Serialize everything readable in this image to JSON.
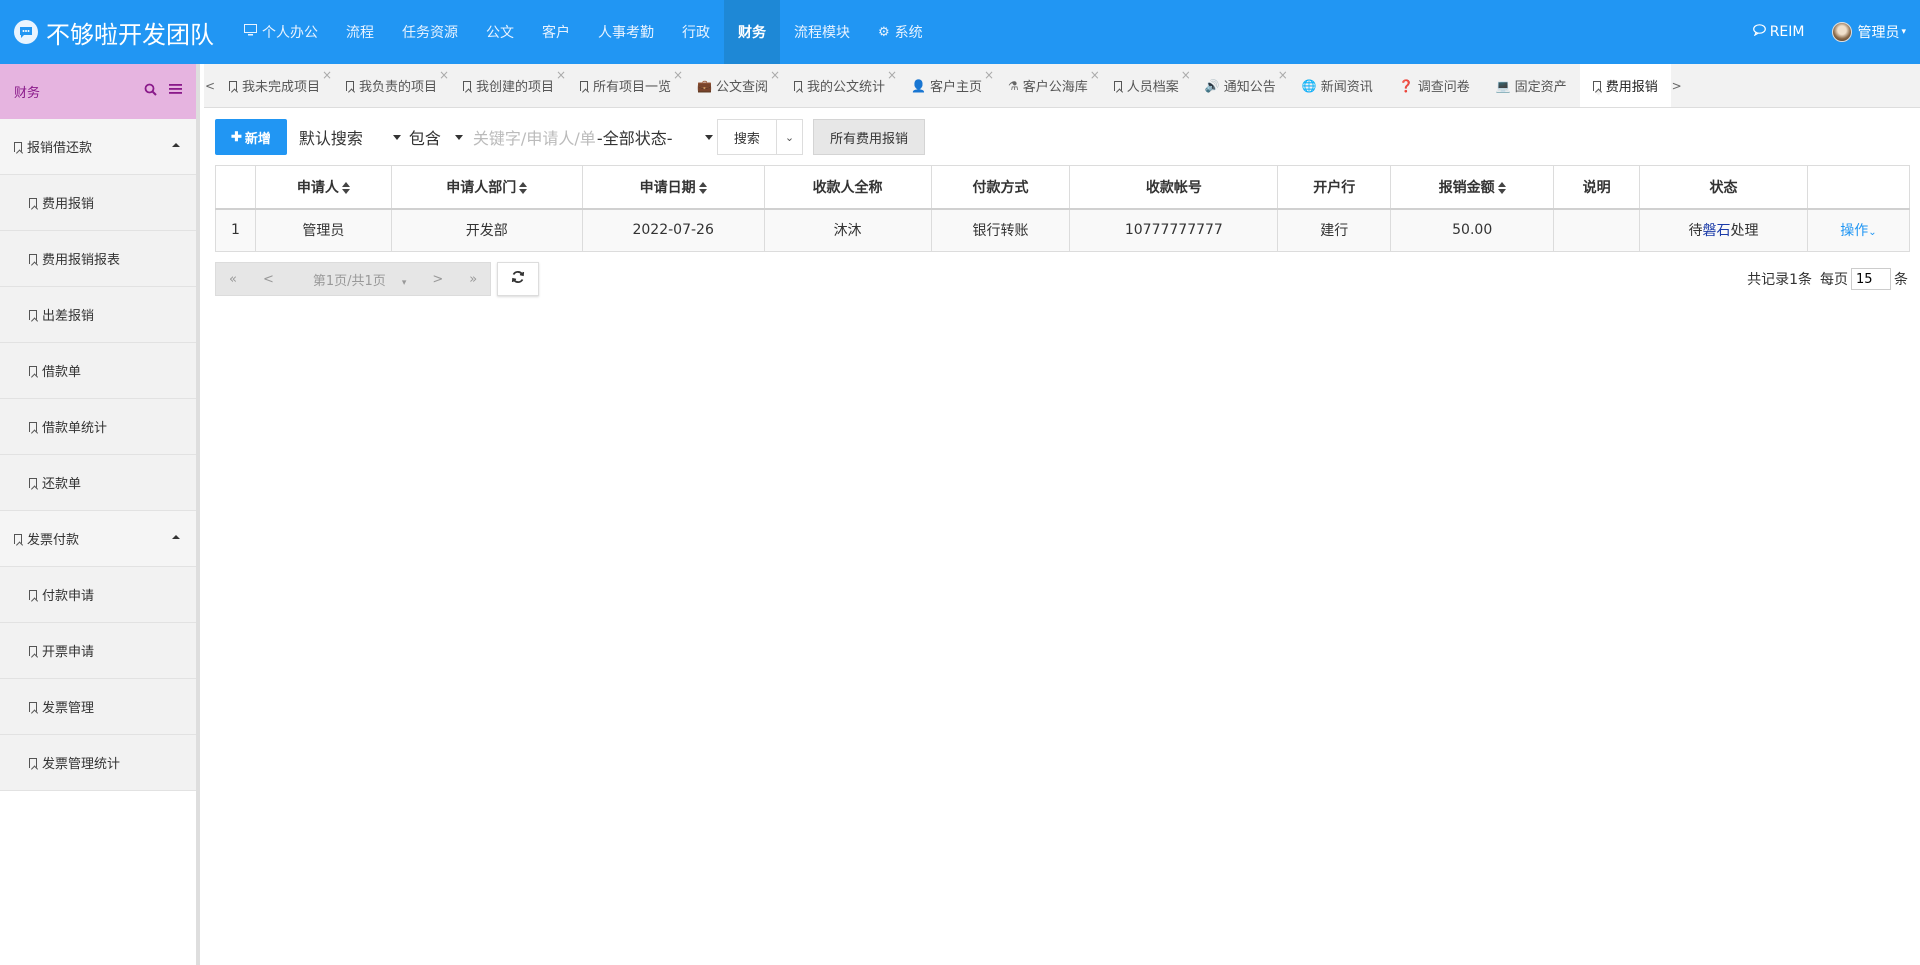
{
  "app": {
    "title": "不够啦开发团队"
  },
  "nav": [
    {
      "label": "个人办公",
      "icon": "monitor-icon"
    },
    {
      "label": "流程"
    },
    {
      "label": "任务资源"
    },
    {
      "label": "公文"
    },
    {
      "label": "客户"
    },
    {
      "label": "人事考勤"
    },
    {
      "label": "行政"
    },
    {
      "label": "财务",
      "active": true
    },
    {
      "label": "流程模块"
    },
    {
      "label": "系统",
      "icon": "gear-icon"
    }
  ],
  "topright": {
    "reim": "REIM",
    "user": "管理员"
  },
  "sidebar": {
    "title": "财务",
    "groups": [
      {
        "label": "报销借还款",
        "items": [
          "费用报销",
          "费用报销报表",
          "出差报销",
          "借款单",
          "借款单统计",
          "还款单"
        ]
      },
      {
        "label": "发票付款",
        "items": [
          "付款申请",
          "开票申请",
          "发票管理",
          "发票管理统计"
        ]
      }
    ]
  },
  "tabs": [
    {
      "label": "我未完成项目",
      "icon": "bookmark-icon"
    },
    {
      "label": "我负责的项目",
      "icon": "bookmark-icon"
    },
    {
      "label": "我创建的项目",
      "icon": "bookmark-icon"
    },
    {
      "label": "所有项目一览",
      "icon": "bookmark-icon"
    },
    {
      "label": "公文查阅",
      "icon": "briefcase-icon"
    },
    {
      "label": "我的公文统计",
      "icon": "bookmark-icon"
    },
    {
      "label": "客户主页",
      "icon": "user-icon"
    },
    {
      "label": "客户公海库",
      "icon": "flask-icon"
    },
    {
      "label": "人员档案",
      "icon": "bookmark-icon"
    },
    {
      "label": "通知公告",
      "icon": "speaker-icon"
    },
    {
      "label": "新闻资讯",
      "icon": "globe-icon"
    },
    {
      "label": "调查问卷",
      "icon": "question-icon"
    },
    {
      "label": "固定资产",
      "icon": "laptop-icon"
    },
    {
      "label": "费用报销",
      "icon": "bookmark-icon",
      "active": true
    }
  ],
  "toolbar": {
    "add_label": "新增",
    "search_mode": "默认搜索",
    "match_mode": "包含",
    "keyword_placeholder": "关键字/申请人/单",
    "status_filter": "-全部状态-",
    "search_label": "搜索",
    "all_label": "所有费用报销"
  },
  "table": {
    "columns": [
      "",
      "申请人",
      "申请人部门",
      "申请日期",
      "收款人全称",
      "付款方式",
      "收款帐号",
      "开户行",
      "报销金额",
      "说明",
      "状态",
      ""
    ],
    "rows": [
      {
        "index": "1",
        "applicant": "管理员",
        "dept": "开发部",
        "date": "2022-07-26",
        "payee": "沐沐",
        "method": "银行转账",
        "account": "10777777777",
        "bank": "建行",
        "amount": "50.00",
        "note": "",
        "status_prefix": "待",
        "status_name": "磐石",
        "status_suffix": "处理",
        "action": "操作"
      }
    ]
  },
  "pager": {
    "first": "«",
    "prev": "<",
    "page_label": "第1页/共1页",
    "next": ">",
    "last": "»",
    "total_text": "共记录1条",
    "per_page_label": "每页",
    "per_page_value": "15",
    "unit": "条"
  }
}
